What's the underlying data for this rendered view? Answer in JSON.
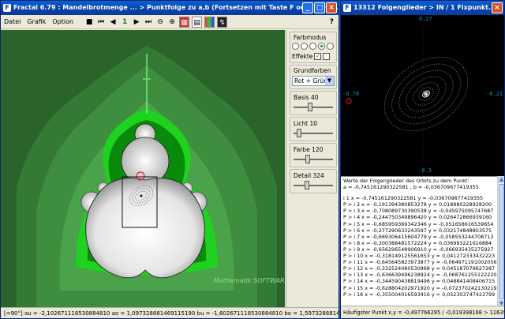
{
  "main_window": {
    "title": "Fractal 6.79 : Mandelbrotmenge ... > Punktfolge zu a,b (Fortsetzen mit Taste F oder Maus...",
    "menu": [
      "Datei",
      "Grafik",
      "Option"
    ],
    "toolbar": {
      "counter": "1",
      "help": "?"
    },
    "panel": {
      "farbmodus_label": "Farbmodus",
      "farbmodus_selected_index": 3,
      "effekte_label": "Effekte",
      "effekte_checked": true,
      "grundfarben_label": "Grundfarben",
      "grundfarben_value": "Rot + Grün",
      "basis_label": "Basis 40",
      "basis_value": 40,
      "licht_label": "Licht 10",
      "licht_value": 10,
      "farbe_label": "Farbe 120",
      "farbe_value": 120,
      "detail_label": "Detail 324",
      "detail_value": 324
    },
    "watermark": "Mathematik SOFTWARE",
    "status": "[=90°]  au = -2,102671118530884810  ao = 1,097328881469115190  bu = -1,602671118530884810  bo = 1,597328881469011151"
  },
  "orbit_window": {
    "title": "13312 Folgenglieder > IN / 1 Fixpunkt...",
    "axis": {
      "top": "0.27",
      "bottom": "-0.3",
      "left": "-0.78",
      "right": "-0.21"
    },
    "info_header_1": "Werte der Folgenglieder des Orbits zu dem Punkt:",
    "info_header_2": "a = -0,745161290322581 , b = -0,036709677419355",
    "rows": [
      "i 1  x = -0,745161290322581  y = -0,036709677419355",
      "P > i 2  x = -0,191394380853278  y = 0,018980228928200",
      "P > i 3  x = -0,708089730390538  y = -0,045975095747687",
      "P > i 4  x = -0,244750349896420  y = 0,026472866939160",
      "P > i 5  x = -0,685959369342346  y = -0,051658616539654",
      "P > i 6  x = -0,277290633243597  y = 0,032174848803575",
      "P > i 7  x = -0,669306415604779  y = -0,058553244708713",
      "P > i 8  x = -0,300388481572224  y = 0,036993221616884",
      "P > i 9  x = -0,656296548906910  y = -0,066935435275927",
      "P > i 10  x = -0,318149125561653  y = 0,041272333432223",
      "P > i 11  x = -0,645645823973877  y = -0,064971191002056",
      "P > i 12  x = -0,332524080530868  y = 0,045187079627287",
      "P > i 13  x = -0,636639496238924  y = -0,068761255122220",
      "P > i 14  x = -0,344590438819496  y = 0,048841408406715",
      "P > i 15  x = -0,628804202971920  y = -0,072370242130219",
      "P > i 16  x = -0,355004016593416  y = 0,052303747423799"
    ],
    "status": "Häufigster Punkt x,y = -0,497766295 / -0,019398168 > 11639x"
  }
}
